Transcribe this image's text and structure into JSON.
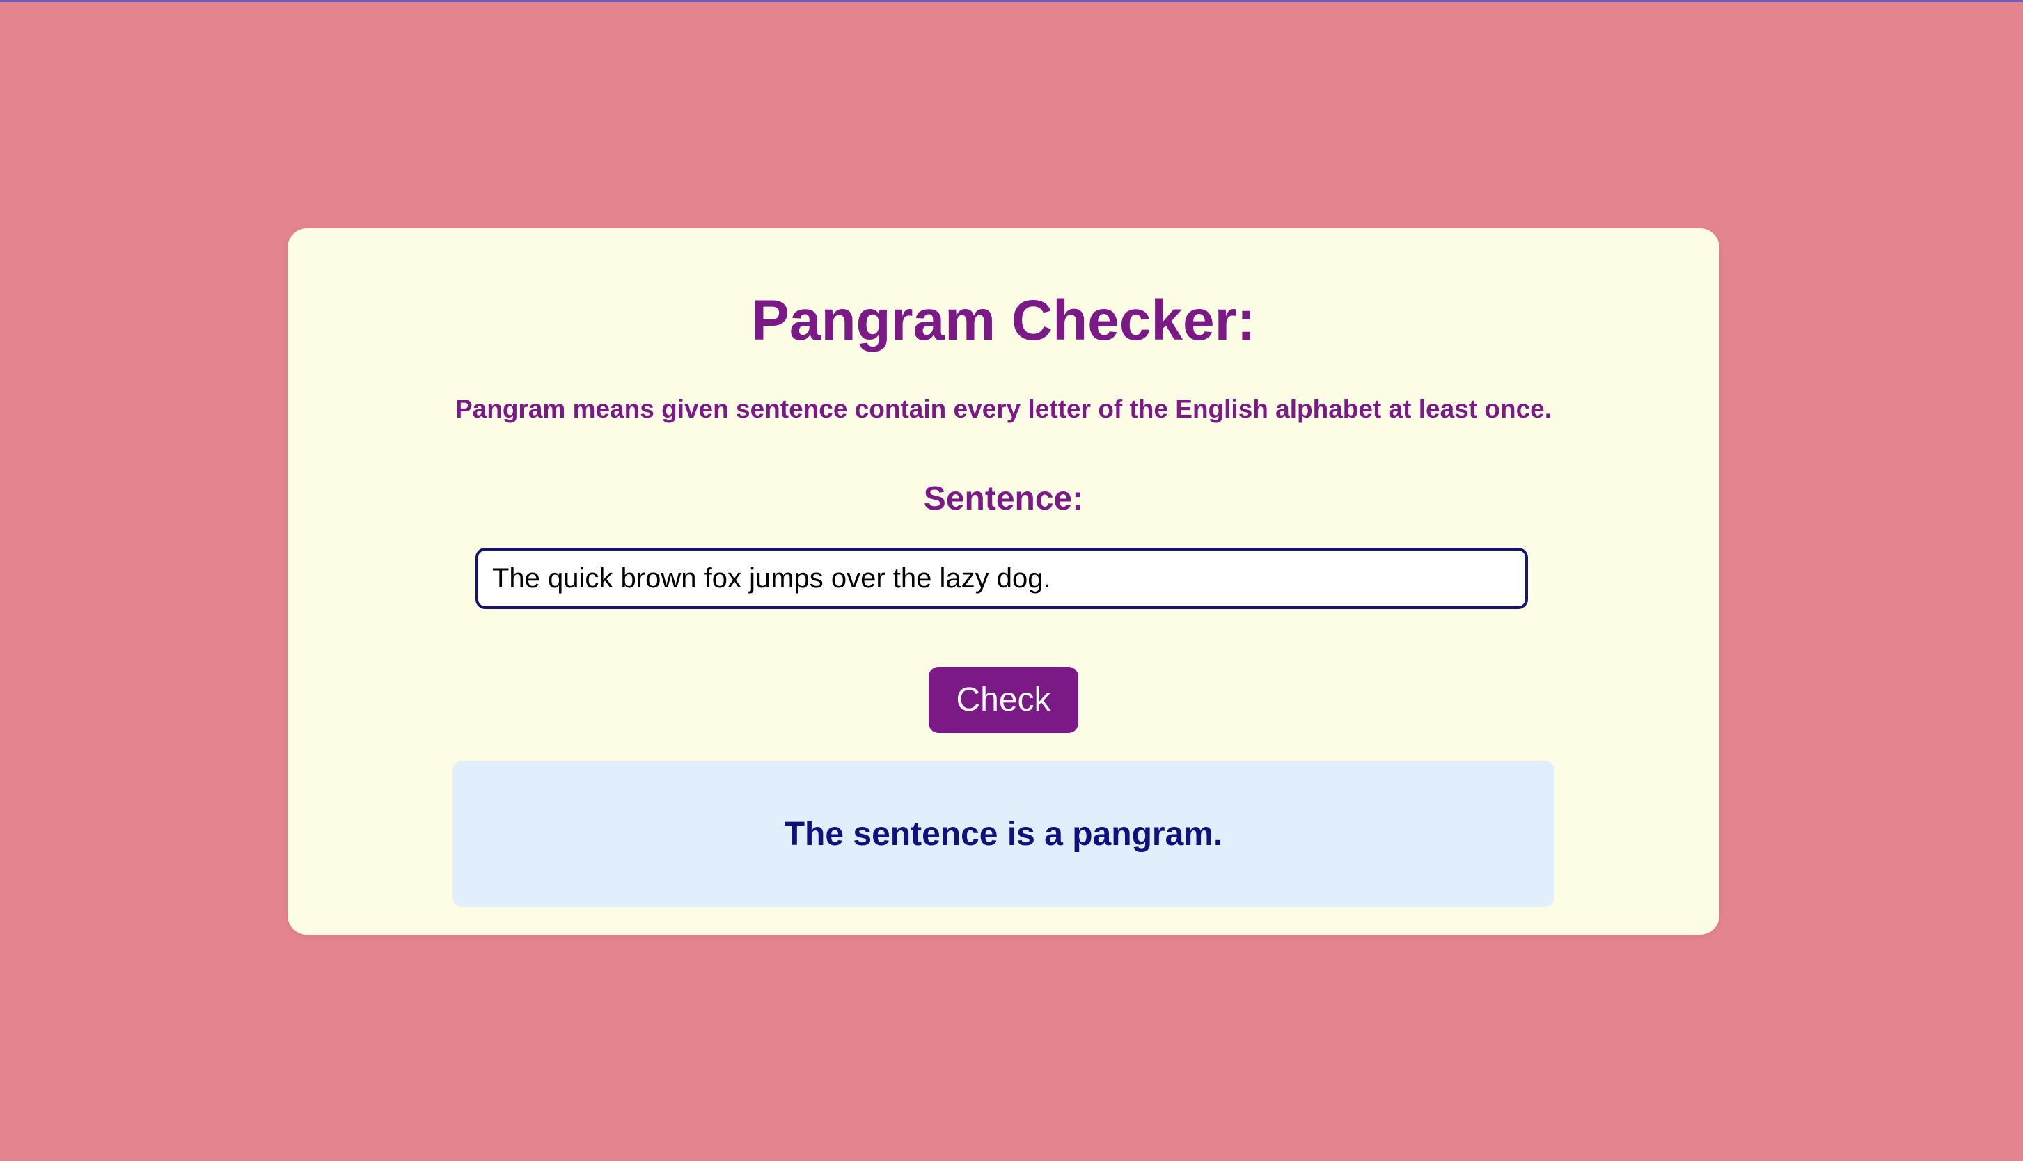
{
  "app": {
    "title": "Pangram Checker:",
    "description": "Pangram means given sentence contain every letter of the English alphabet at least once."
  },
  "form": {
    "sentence_label": "Sentence:",
    "sentence_value": "The quick brown fox jumps over the lazy dog.",
    "check_button_label": "Check"
  },
  "result": {
    "message": "The sentence is a pangram."
  },
  "colors": {
    "page_background": "#e4848f",
    "card_background": "#fdfde6",
    "accent_purple": "#7b1a86",
    "input_border": "#14156e",
    "result_background": "#e1eefb",
    "result_text": "#0f117c"
  }
}
